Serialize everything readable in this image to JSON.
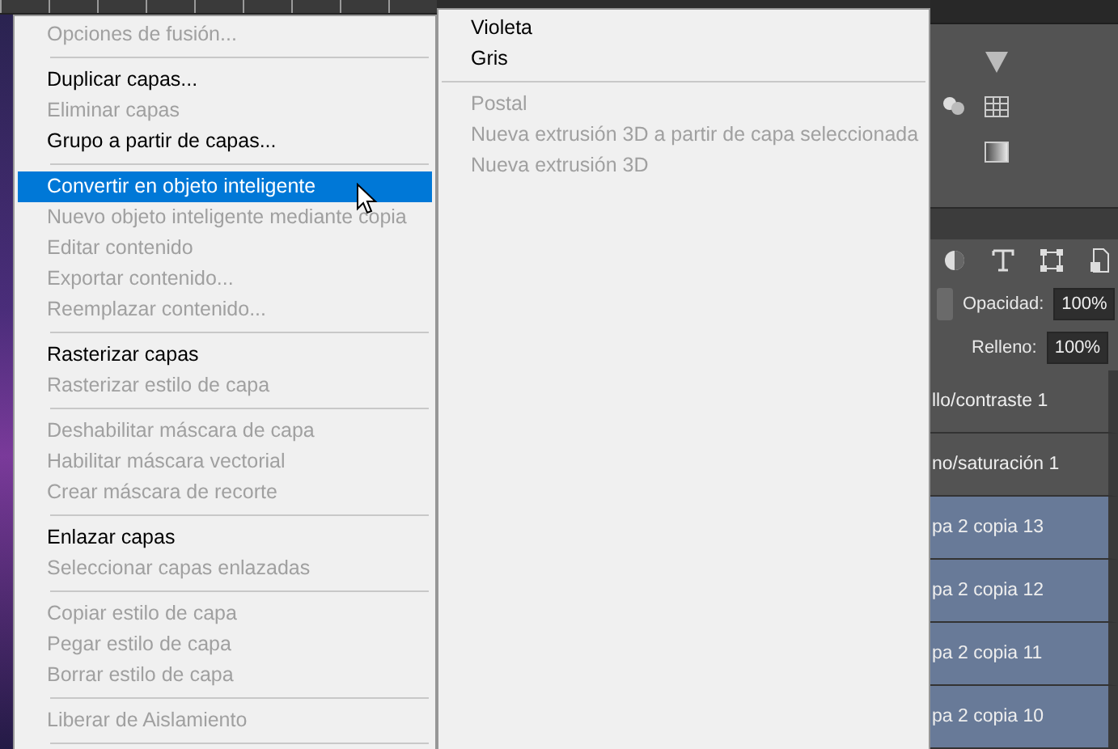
{
  "context_menu": {
    "items": [
      {
        "kind": "item",
        "label": "Opciones de fusión...",
        "disabled": true,
        "selected": false
      },
      {
        "kind": "separator"
      },
      {
        "kind": "item",
        "label": "Duplicar capas...",
        "disabled": false,
        "selected": false
      },
      {
        "kind": "item",
        "label": "Eliminar capas",
        "disabled": true,
        "selected": false
      },
      {
        "kind": "item",
        "label": "Grupo a partir de capas...",
        "disabled": false,
        "selected": false
      },
      {
        "kind": "separator"
      },
      {
        "kind": "item",
        "label": "Convertir en objeto inteligente",
        "disabled": false,
        "selected": true
      },
      {
        "kind": "item",
        "label": "Nuevo objeto inteligente mediante copia",
        "disabled": true,
        "selected": false
      },
      {
        "kind": "item",
        "label": "Editar contenido",
        "disabled": true,
        "selected": false
      },
      {
        "kind": "item",
        "label": "Exportar contenido...",
        "disabled": true,
        "selected": false
      },
      {
        "kind": "item",
        "label": "Reemplazar contenido...",
        "disabled": true,
        "selected": false
      },
      {
        "kind": "separator"
      },
      {
        "kind": "item",
        "label": "Rasterizar capas",
        "disabled": false,
        "selected": false
      },
      {
        "kind": "item",
        "label": "Rasterizar estilo de capa",
        "disabled": true,
        "selected": false
      },
      {
        "kind": "separator"
      },
      {
        "kind": "item",
        "label": "Deshabilitar máscara de capa",
        "disabled": true,
        "selected": false
      },
      {
        "kind": "item",
        "label": "Habilitar máscara vectorial",
        "disabled": true,
        "selected": false
      },
      {
        "kind": "item",
        "label": "Crear máscara de recorte",
        "disabled": true,
        "selected": false
      },
      {
        "kind": "separator"
      },
      {
        "kind": "item",
        "label": "Enlazar capas",
        "disabled": false,
        "selected": false
      },
      {
        "kind": "item",
        "label": "Seleccionar capas enlazadas",
        "disabled": true,
        "selected": false
      },
      {
        "kind": "separator"
      },
      {
        "kind": "item",
        "label": "Copiar estilo de capa",
        "disabled": true,
        "selected": false
      },
      {
        "kind": "item",
        "label": "Pegar estilo de capa",
        "disabled": true,
        "selected": false
      },
      {
        "kind": "item",
        "label": "Borrar estilo de capa",
        "disabled": true,
        "selected": false
      },
      {
        "kind": "separator"
      },
      {
        "kind": "item",
        "label": "Liberar de Aislamiento",
        "disabled": true,
        "selected": false
      },
      {
        "kind": "separator"
      }
    ]
  },
  "submenu": {
    "items": [
      {
        "kind": "item",
        "label": "Violeta",
        "disabled": false
      },
      {
        "kind": "item",
        "label": "Gris",
        "disabled": false
      },
      {
        "kind": "separator"
      },
      {
        "kind": "item",
        "label": "Postal",
        "disabled": true
      },
      {
        "kind": "item",
        "label": "Nueva extrusión 3D a partir de capa seleccionada",
        "disabled": true
      },
      {
        "kind": "item",
        "label": "Nueva extrusión 3D",
        "disabled": true
      }
    ]
  },
  "layers_panel": {
    "opacity_label": "Opacidad:",
    "opacity_value": "100%",
    "fill_label": "Relleno:",
    "fill_value": "100%",
    "layers": [
      {
        "name": "llo/contraste 1",
        "selected": false
      },
      {
        "name": "no/saturación 1",
        "selected": false
      },
      {
        "name": "pa 2 copia 13",
        "selected": true
      },
      {
        "name": "pa 2 copia 12",
        "selected": true
      },
      {
        "name": "pa 2 copia 11",
        "selected": true
      },
      {
        "name": "pa 2 copia 10",
        "selected": true
      }
    ]
  }
}
